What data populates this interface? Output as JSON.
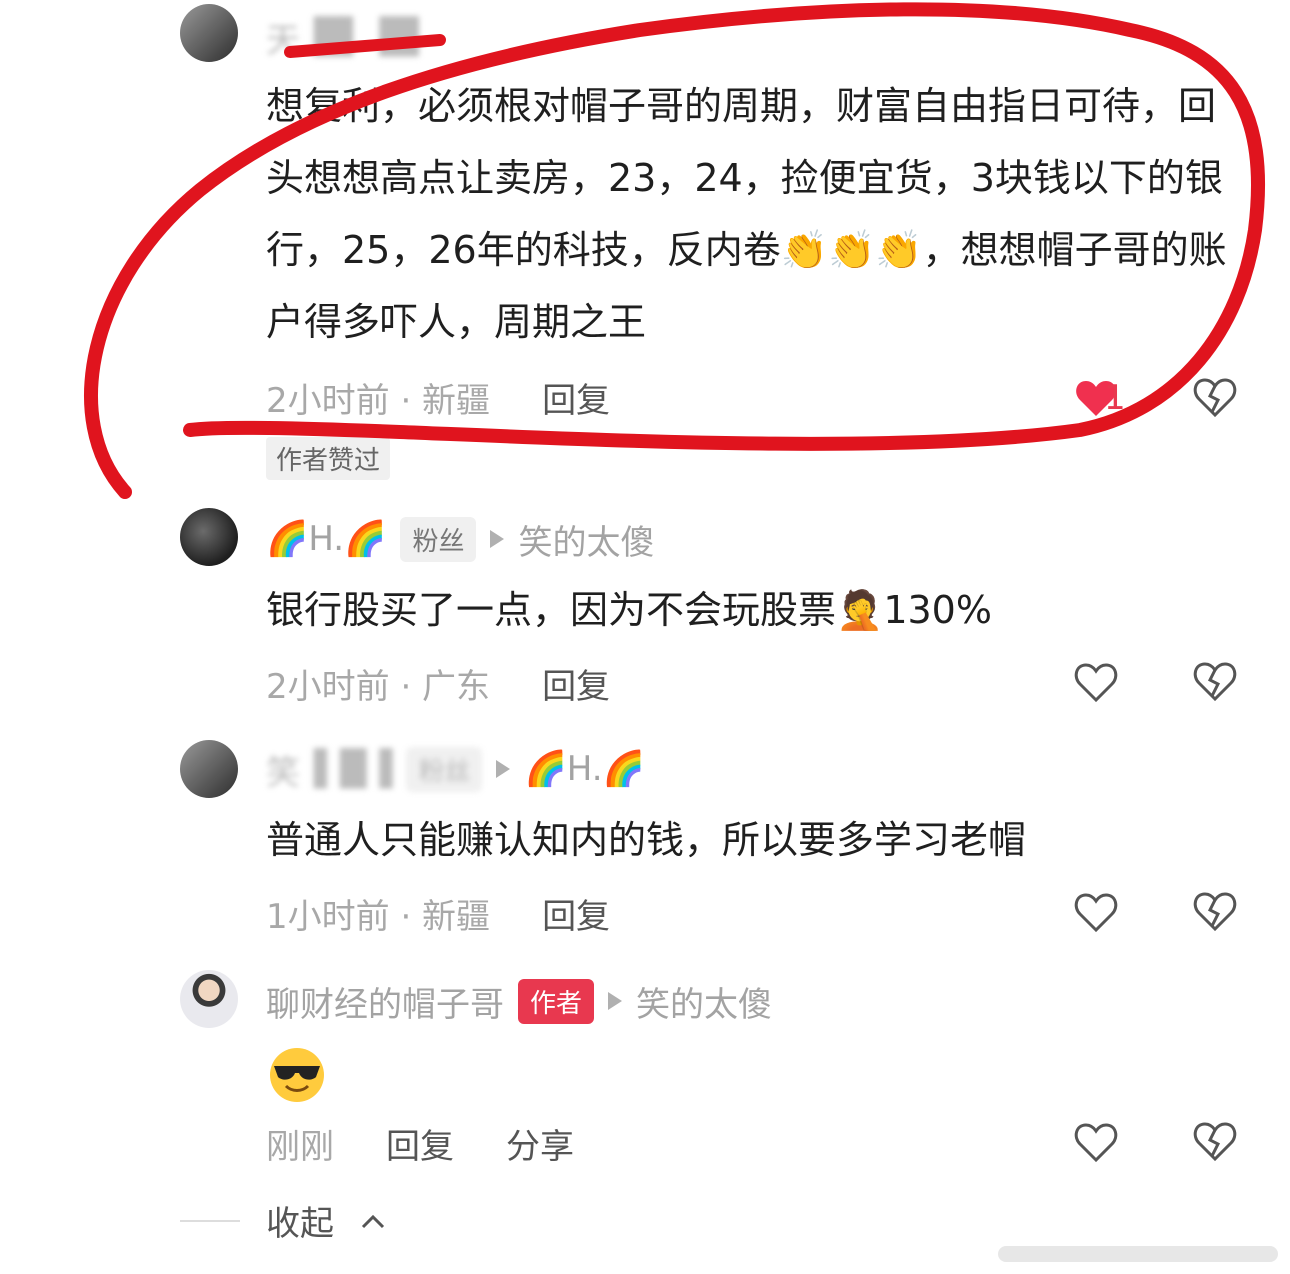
{
  "comments": [
    {
      "name": "天",
      "badge": "",
      "text": "想复利，必须根对帽子哥的周期，财富自由指日可待，回头想想高点让卖房，23，24，捡便宜货，3块钱以下的银行，25，26年的科技，反内卷👏👏👏，想想帽子哥的账户得多吓人，周期之王",
      "time": "2小时前 · 新疆",
      "reply": "回复",
      "likes": "1",
      "tag": "作者赞过"
    },
    {
      "name": "🌈H.🌈",
      "badge": "粉丝",
      "reply_to": "笑的太傻",
      "text": "银行股买了一点，因为不会玩股票🤦130%",
      "time": "2小时前 · 广东",
      "reply": "回复"
    },
    {
      "name": "笑",
      "badge": "粉丝",
      "reply_to": "🌈H.🌈",
      "text": "普通人只能赚认知内的钱，所以要多学习老帽",
      "time": "1小时前 · 新疆",
      "reply": "回复"
    },
    {
      "name": "聊财经的帽子哥",
      "badge": "作者",
      "reply_to": "笑的太傻",
      "text": "",
      "time": "刚刚",
      "reply": "回复",
      "share": "分享"
    }
  ],
  "collapse": "收起",
  "icons": {
    "like": "heart-icon",
    "dislike": "broken-heart-icon",
    "liked_color": "#f0304f"
  },
  "annotation_color": "#e0141e"
}
